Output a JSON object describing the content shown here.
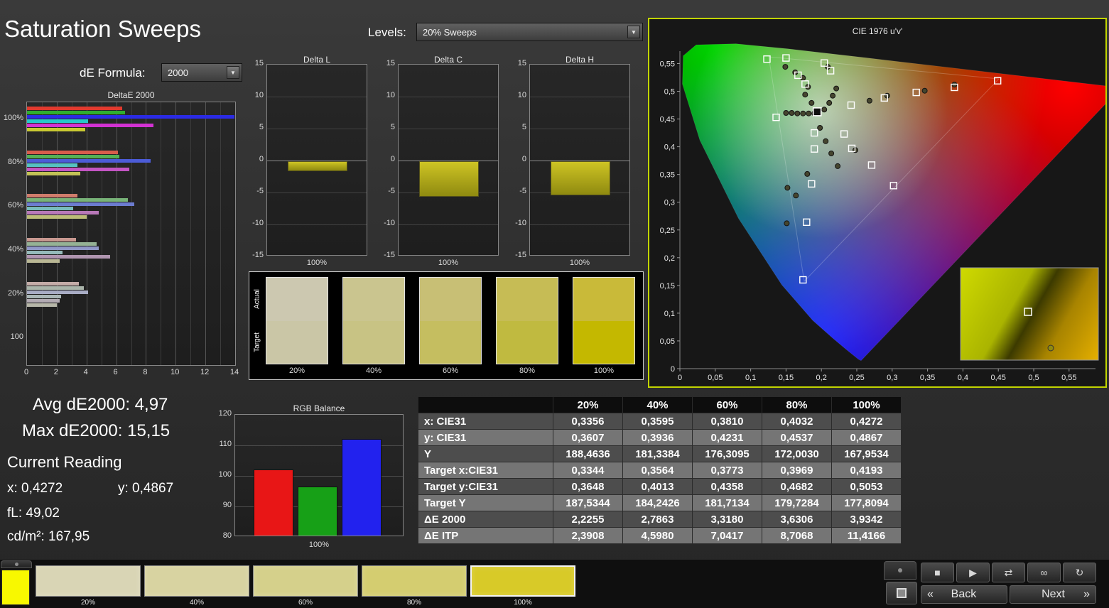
{
  "header": {
    "title": "Saturation Sweeps",
    "de_formula_label": "dE Formula:",
    "de_formula_value": "2000",
    "levels_label": "Levels:",
    "levels_value": "20% Sweeps"
  },
  "readings": {
    "avg": "Avg dE2000: 4,97",
    "max": "Max dE2000: 15,15",
    "current_heading": "Current Reading",
    "x": "x: 0,4272",
    "y": "y: 0,4867",
    "fl": "fL: 49,02",
    "cd": "cd/m²: 167,95"
  },
  "swatch_strip": {
    "row_labels": [
      "Actual",
      "Target"
    ],
    "levels": [
      "20%",
      "40%",
      "60%",
      "80%",
      "100%"
    ],
    "actual_colors": [
      "#ccc8b0",
      "#cac58f",
      "#c8bf75",
      "#c6bc55",
      "#c9ba39"
    ],
    "target_colors": [
      "#cac6a6",
      "#c8c384",
      "#c5be60",
      "#c0ba40",
      "#c4b800"
    ]
  },
  "table": {
    "header": [
      "",
      "20%",
      "40%",
      "60%",
      "80%",
      "100%"
    ],
    "rows": [
      {
        "label": "x: CIE31",
        "values": [
          "0,3356",
          "0,3595",
          "0,3810",
          "0,4032",
          "0,4272"
        ]
      },
      {
        "label": "y: CIE31",
        "values": [
          "0,3607",
          "0,3936",
          "0,4231",
          "0,4537",
          "0,4867"
        ]
      },
      {
        "label": "Y",
        "values": [
          "188,4636",
          "181,3384",
          "176,3095",
          "172,0030",
          "167,9534"
        ]
      },
      {
        "label": "Target x:CIE31",
        "values": [
          "0,3344",
          "0,3564",
          "0,3773",
          "0,3969",
          "0,4193"
        ]
      },
      {
        "label": "Target y:CIE31",
        "values": [
          "0,3648",
          "0,4013",
          "0,4358",
          "0,4682",
          "0,5053"
        ]
      },
      {
        "label": "Target Y",
        "values": [
          "187,5344",
          "184,2426",
          "181,7134",
          "179,7284",
          "177,8094"
        ]
      },
      {
        "label": "ΔE 2000",
        "values": [
          "2,2255",
          "2,7863",
          "3,3180",
          "3,6306",
          "3,9342"
        ]
      },
      {
        "label": "ΔE ITP",
        "values": [
          "2,3908",
          "4,5980",
          "7,0417",
          "8,7068",
          "11,4166"
        ]
      }
    ]
  },
  "transport": {
    "icons": {
      "stop": "■",
      "play": "▶",
      "step": "⇄",
      "continuous": "∞",
      "loop": "↻"
    }
  },
  "bottom_bar": {
    "active_patch_color": "#f8f800",
    "patches": [
      {
        "label": "20%",
        "color": "#d9d5b5",
        "selected": false
      },
      {
        "label": "40%",
        "color": "#d8d3a1",
        "selected": false
      },
      {
        "label": "60%",
        "color": "#d5d08b",
        "selected": false
      },
      {
        "label": "80%",
        "color": "#d4cd70",
        "selected": false
      },
      {
        "label": "100%",
        "color": "#d8ca28",
        "selected": true
      }
    ],
    "back_chevron": "«",
    "back_label": "Back",
    "next_label": "Next",
    "next_chevron": "»"
  },
  "chart_data": [
    {
      "id": "deltae_sweep",
      "type": "bar",
      "orientation": "horizontal",
      "title": "DeltaE 2000",
      "categories": [
        "100%",
        "80%",
        "60%",
        "40%",
        "20%",
        "100"
      ],
      "series_order": [
        "red",
        "green",
        "blue",
        "cyan",
        "magenta",
        "yellow"
      ],
      "values": [
        [
          6.4,
          6.6,
          15.15,
          4.1,
          8.5,
          3.9
        ],
        [
          6.1,
          6.2,
          8.3,
          3.4,
          6.9,
          3.6
        ],
        [
          3.4,
          6.8,
          7.2,
          3.1,
          4.8,
          4.0
        ],
        [
          3.3,
          4.7,
          4.8,
          2.4,
          5.6,
          2.2
        ],
        [
          3.5,
          3.8,
          4.1,
          2.3,
          2.2,
          2.0
        ],
        [
          0,
          0,
          0,
          0,
          0,
          0
        ]
      ],
      "bar_colors": [
        [
          "#e23a2e",
          "#2fae2f",
          "#2b2be4",
          "#25c9c9",
          "#d332d3",
          "#c9c932"
        ],
        [
          "#d85c4c",
          "#55b055",
          "#4c5cd8",
          "#55c2c2",
          "#c355c3",
          "#c2c255"
        ],
        [
          "#d07c6c",
          "#78b378",
          "#6c7cd0",
          "#78bcbc",
          "#b878b8",
          "#bcbc78"
        ],
        [
          "#c89890",
          "#95b295",
          "#9098c8",
          "#95baba",
          "#b095b0",
          "#bab895"
        ],
        [
          "#c4aca8",
          "#aab4aa",
          "#a8acc4",
          "#aab6b6",
          "#b2aab2",
          "#b6b6a8"
        ],
        [
          "#9a9a9a",
          "#9a9a9a",
          "#9a9a9a",
          "#9a9a9a",
          "#9a9a9a",
          "#9a9a9a"
        ]
      ],
      "xticks": [
        0,
        2,
        4,
        6,
        8,
        10,
        12,
        14
      ],
      "xlim": [
        0,
        14
      ]
    },
    {
      "id": "delta_l",
      "type": "bar",
      "title": "Delta L",
      "categories": [
        "100%"
      ],
      "values": [
        -1.5
      ],
      "ylim": [
        -15,
        15
      ],
      "yticks": [
        15,
        10,
        5,
        0,
        -5,
        -10,
        -15
      ],
      "bar_color": "#b6ac1c"
    },
    {
      "id": "delta_c",
      "type": "bar",
      "title": "Delta C",
      "categories": [
        "100%"
      ],
      "values": [
        -5.5
      ],
      "ylim": [
        -15,
        15
      ],
      "yticks": [
        15,
        10,
        5,
        0,
        -5,
        -10,
        -15
      ],
      "bar_color": "#b6ac1c"
    },
    {
      "id": "delta_h",
      "type": "bar",
      "title": "Delta H",
      "categories": [
        "100%"
      ],
      "values": [
        -5.3
      ],
      "ylim": [
        -15,
        15
      ],
      "yticks": [
        15,
        10,
        5,
        0,
        -5,
        -10,
        -15
      ],
      "bar_color": "#b6ac1c"
    },
    {
      "id": "rgb_balance",
      "type": "bar",
      "title": "RGB Balance",
      "categories": [
        "Red",
        "Green",
        "Blue"
      ],
      "values": [
        102,
        96.5,
        112
      ],
      "bar_colors": [
        "#e81616",
        "#17a017",
        "#2222ee"
      ],
      "ylim": [
        80,
        120
      ],
      "yticks": [
        120,
        110,
        100,
        90,
        80
      ],
      "xlabel": "100%"
    },
    {
      "id": "cie_diagram",
      "type": "scatter",
      "title": "CIE 1976 u'v'",
      "xlim": [
        0,
        0.6
      ],
      "ylim": [
        0,
        0.6
      ],
      "xticks": [
        "0",
        "0,05",
        "0,1",
        "0,15",
        "0,2",
        "0,25",
        "0,3",
        "0,35",
        "0,4",
        "0,45",
        "0,5",
        "0,55"
      ],
      "yticks": [
        "0",
        "0,05",
        "0,1",
        "0,15",
        "0,2",
        "0,25",
        "0,3",
        "0,35",
        "0,4",
        "0,45",
        "0,5",
        "0,55"
      ],
      "targets": [
        [
          0.123,
          0.558
        ],
        [
          0.15,
          0.56
        ],
        [
          0.204,
          0.551
        ],
        [
          0.213,
          0.537
        ],
        [
          0.167,
          0.529
        ],
        [
          0.177,
          0.513
        ],
        [
          0.449,
          0.519
        ],
        [
          0.388,
          0.507
        ],
        [
          0.334,
          0.498
        ],
        [
          0.289,
          0.488
        ],
        [
          0.242,
          0.475
        ],
        [
          0.136,
          0.453
        ],
        [
          0.19,
          0.425
        ],
        [
          0.232,
          0.423
        ],
        [
          0.19,
          0.396
        ],
        [
          0.243,
          0.397
        ],
        [
          0.271,
          0.367
        ],
        [
          0.186,
          0.333
        ],
        [
          0.302,
          0.33
        ],
        [
          0.179,
          0.264
        ],
        [
          0.174,
          0.16
        ]
      ],
      "measurements": [
        [
          0.149,
          0.544
        ],
        [
          0.163,
          0.534
        ],
        [
          0.174,
          0.524
        ],
        [
          0.181,
          0.508
        ],
        [
          0.177,
          0.494
        ],
        [
          0.186,
          0.479
        ],
        [
          0.15,
          0.461
        ],
        [
          0.158,
          0.461
        ],
        [
          0.166,
          0.46
        ],
        [
          0.174,
          0.46
        ],
        [
          0.182,
          0.46
        ],
        [
          0.19,
          0.46
        ],
        [
          0.204,
          0.467
        ],
        [
          0.211,
          0.479
        ],
        [
          0.216,
          0.492
        ],
        [
          0.221,
          0.505
        ],
        [
          0.209,
          0.544
        ],
        [
          0.268,
          0.483
        ],
        [
          0.293,
          0.492
        ],
        [
          0.346,
          0.501
        ],
        [
          0.388,
          0.512
        ],
        [
          0.198,
          0.434
        ],
        [
          0.206,
          0.41
        ],
        [
          0.214,
          0.388
        ],
        [
          0.223,
          0.365
        ],
        [
          0.248,
          0.394
        ],
        [
          0.164,
          0.312
        ],
        [
          0.152,
          0.326
        ],
        [
          0.18,
          0.351
        ],
        [
          0.151,
          0.262
        ]
      ],
      "selected": [
        0.194,
        0.463
      ]
    }
  ]
}
